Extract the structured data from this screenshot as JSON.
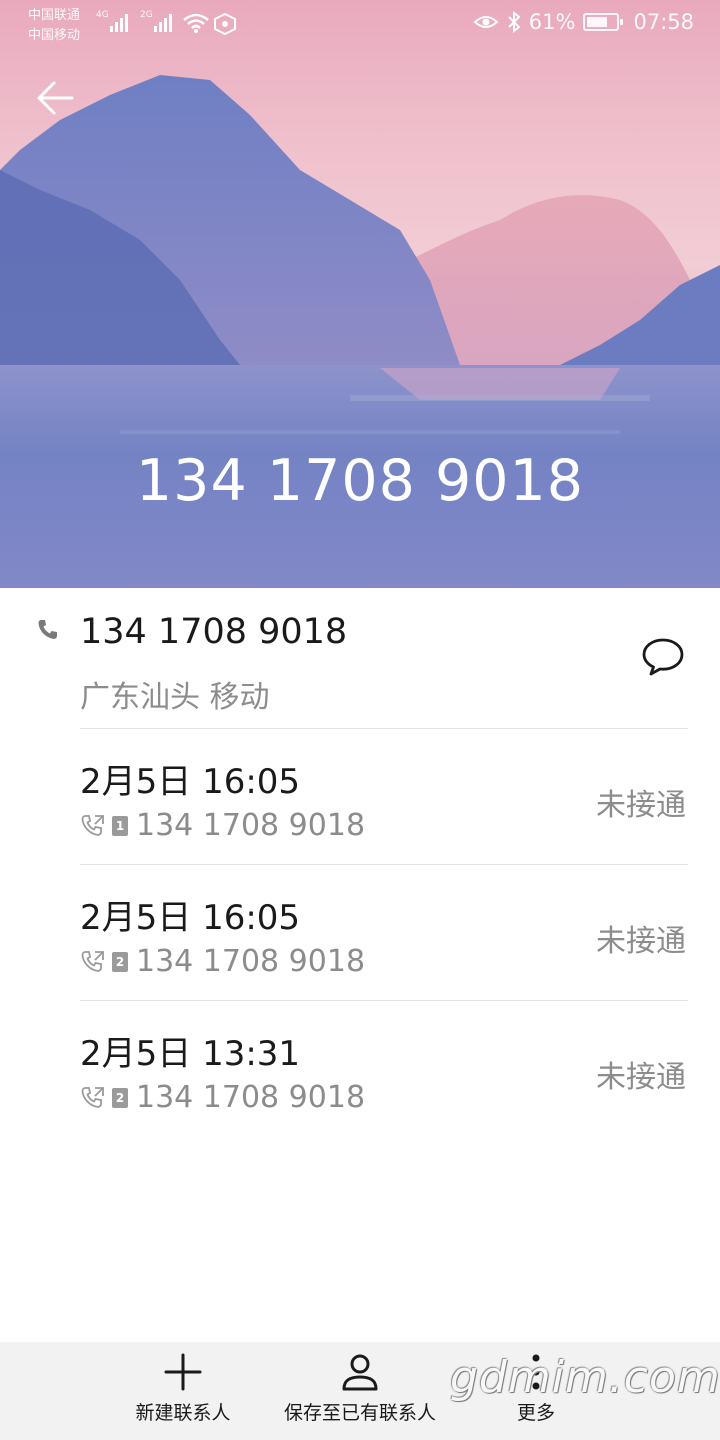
{
  "status_bar": {
    "carrier_1": "中国联通",
    "carrier_2": "中国移动",
    "network_1": "4G",
    "network_2": "2G",
    "battery": "61%",
    "time": "07:58"
  },
  "header": {
    "back_icon": "arrow-left-icon",
    "number": "134 1708 9018"
  },
  "contact_info": {
    "number": "134 1708 9018",
    "location": "广东汕头 移动",
    "phone_icon": "phone-icon",
    "message_icon": "message-bubble-icon"
  },
  "call_records": [
    {
      "time": "2月5日 16:05",
      "sim": "1",
      "number": "134 1708 9018",
      "status": "未接通"
    },
    {
      "time": "2月5日 16:05",
      "sim": "2",
      "number": "134 1708 9018",
      "status": "未接通"
    },
    {
      "time": "2月5日 13:31",
      "sim": "2",
      "number": "134 1708 9018",
      "status": "未接通"
    }
  ],
  "bottom_bar": {
    "new_contact": "新建联系人",
    "save_existing": "保存至已有联系人",
    "more": "更多"
  },
  "watermark": "gdmim.com",
  "colors": {
    "primary_text": "#1a1a1a",
    "secondary_text": "#8c8c8c",
    "divider": "#e4e4e4",
    "bottom_bar_bg": "#f2f2f2"
  }
}
